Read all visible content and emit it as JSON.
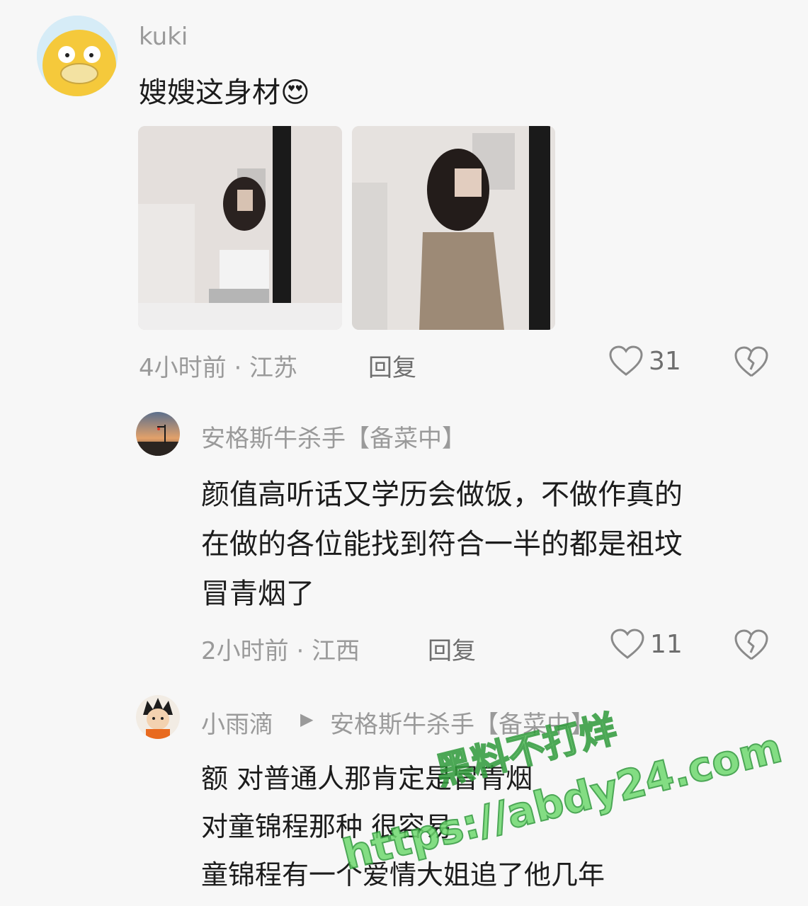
{
  "comments": [
    {
      "author": "kuki",
      "text": "嫂嫂这身材",
      "emoji": "😍",
      "time_location": "4小时前 · 江苏",
      "reply_label": "回复",
      "likes": "31",
      "avatar_icon": "psyduck-avatar-icon"
    },
    {
      "author": "安格斯牛杀手【备菜中】",
      "text_lines": [
        "颜值高听话又学历会做饭，不做作真的",
        "在做的各位能找到符合一半的都是祖坟",
        "冒青烟了"
      ],
      "time_location": "2小时前 · 江西",
      "reply_label": "回复",
      "likes": "11",
      "avatar_icon": "sunset-street-avatar-icon"
    },
    {
      "author": "小雨滴",
      "reply_to": "安格斯牛杀手【备菜中】",
      "text_lines": [
        "额 对普通人那肯定是冒青烟",
        "对童锦程那种 很容易",
        "童锦程有一个爱情大姐追了他几年"
      ],
      "avatar_icon": "cartoon-boy-avatar-icon"
    }
  ],
  "watermark": {
    "line1": "黑料不打烊",
    "line2": "https://abdy24.com"
  },
  "colors": {
    "background": "#f7f7f7",
    "muted_text": "#9a9a9a",
    "main_text": "#1c1c1c",
    "watermark": "#6fd96f"
  }
}
